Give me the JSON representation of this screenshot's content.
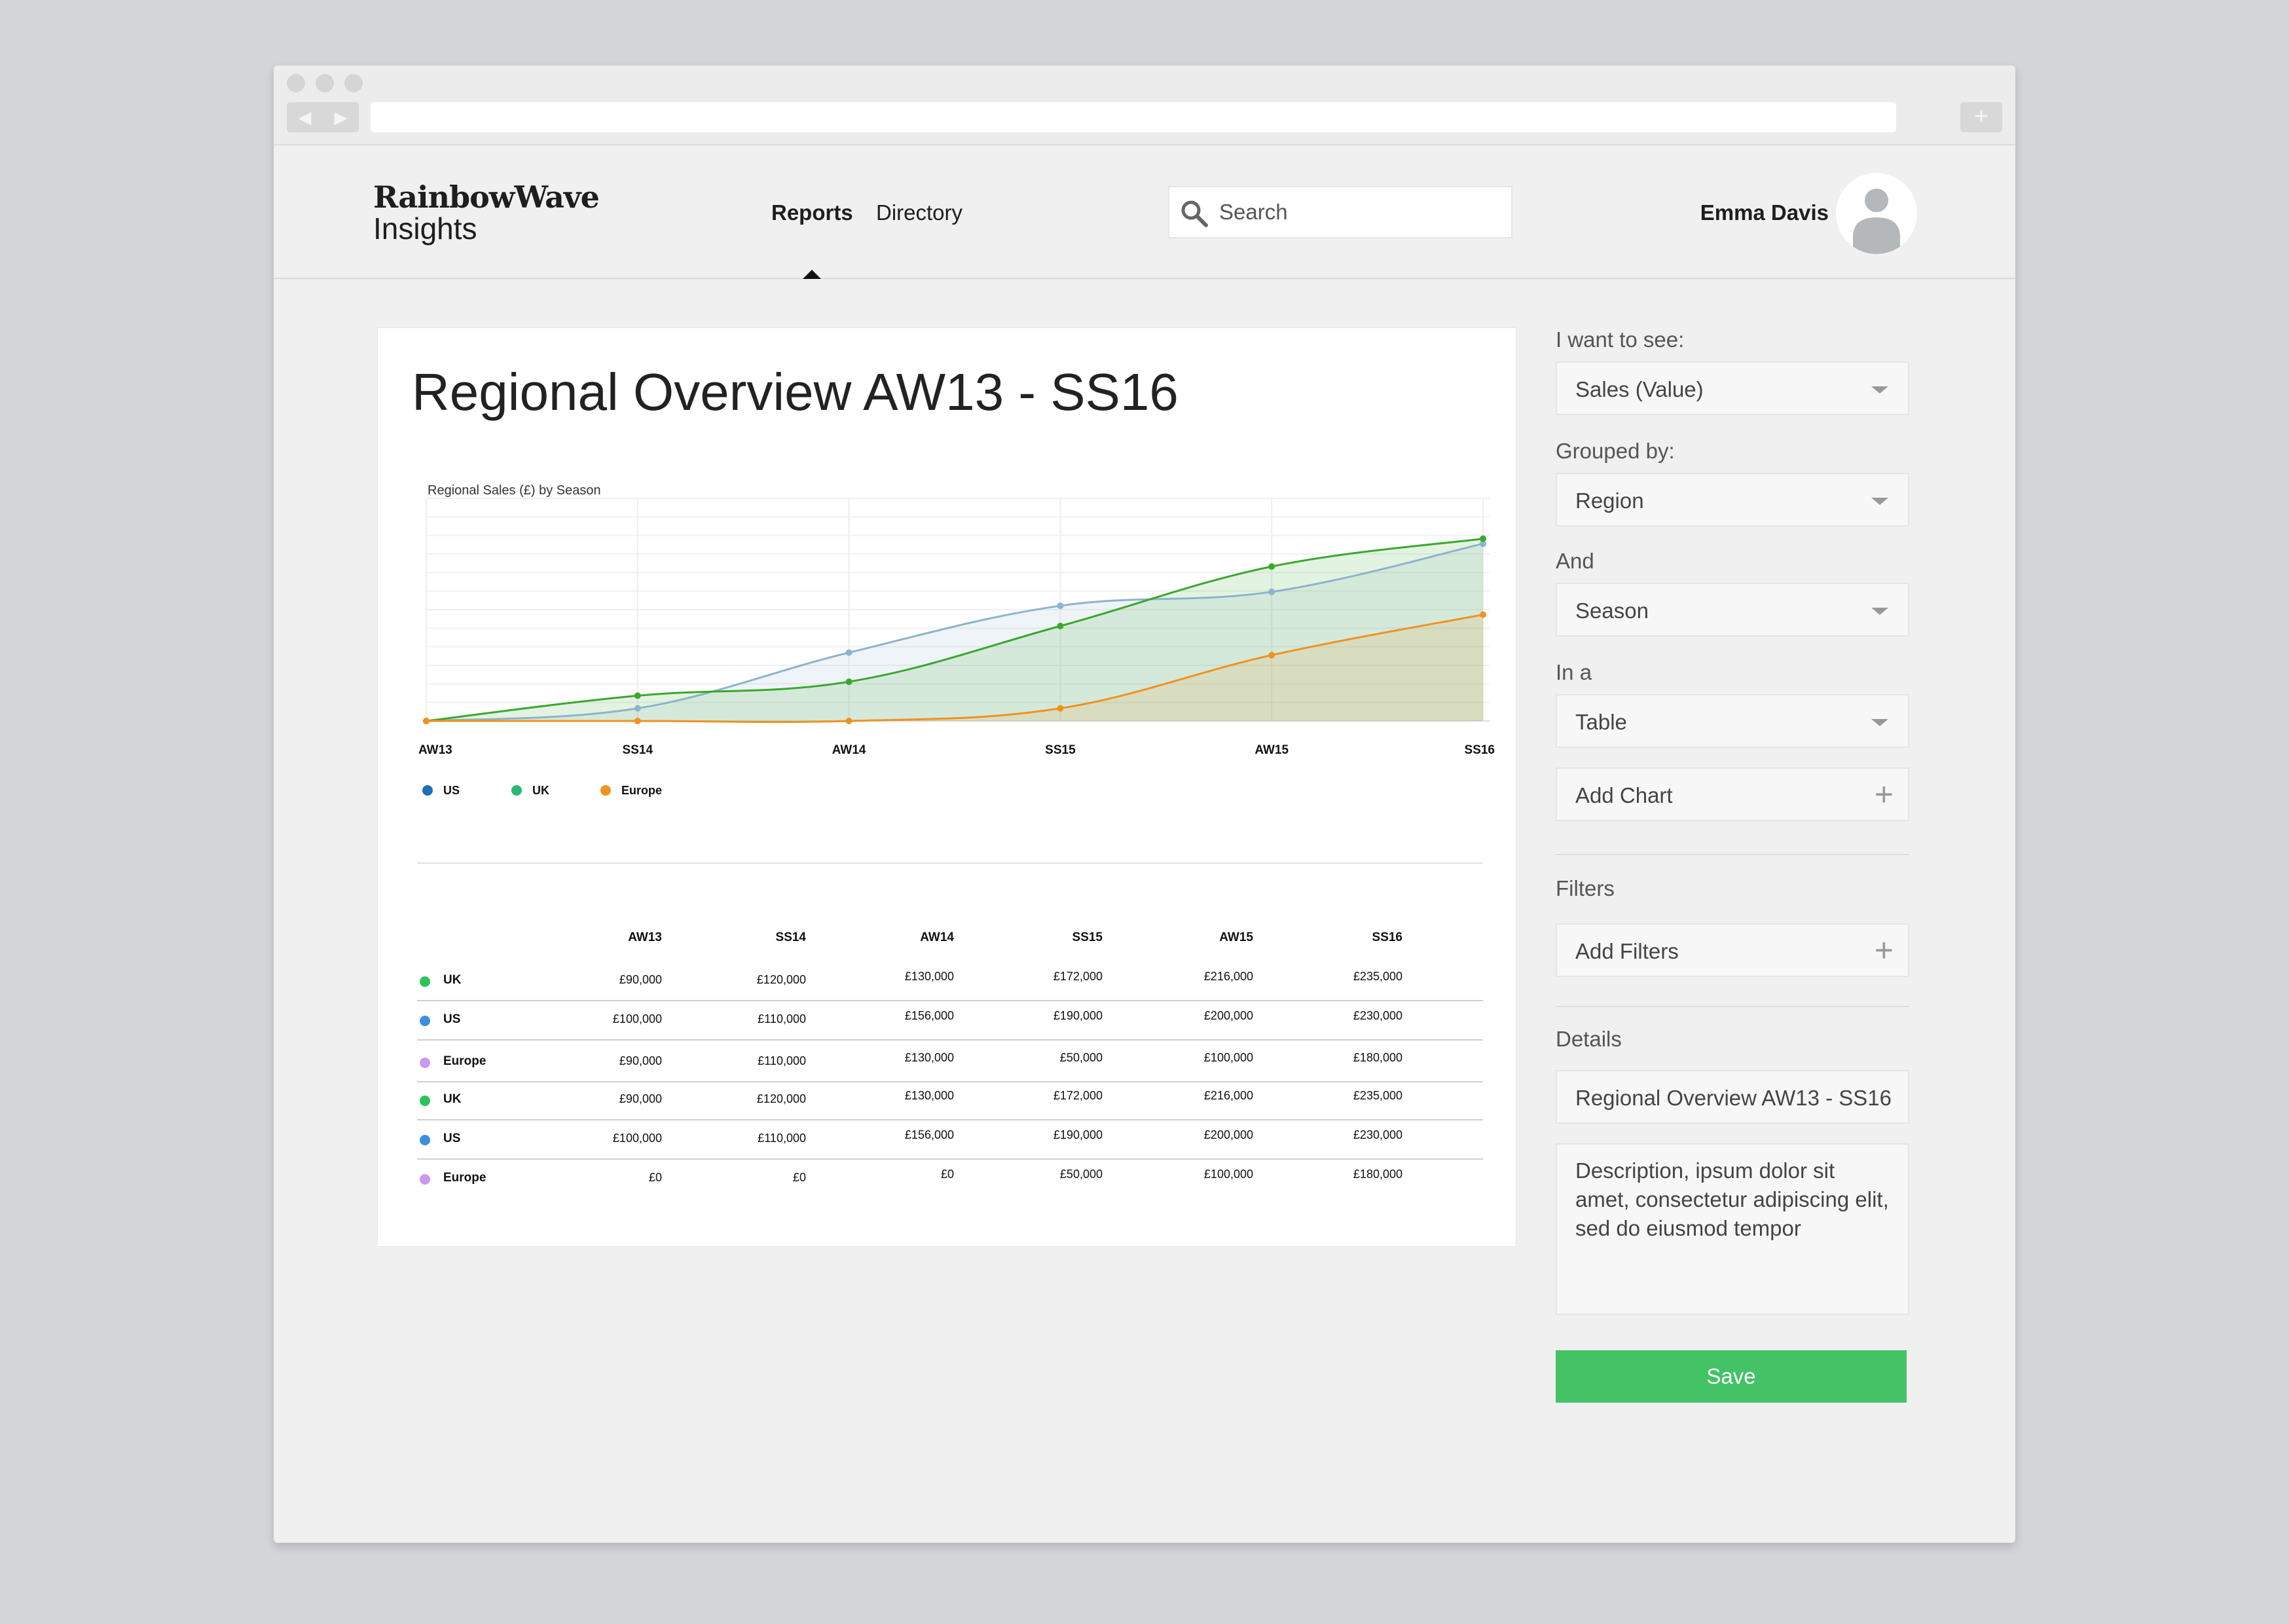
{
  "brand": {
    "line1": "RainbowWave",
    "line2": "Insights"
  },
  "nav": {
    "reports": "Reports",
    "directory": "Directory"
  },
  "search": {
    "placeholder": "Search"
  },
  "user": {
    "name": "Emma Davis"
  },
  "report": {
    "title": "Regional Overview AW13 - SS16"
  },
  "chart_data": {
    "type": "area",
    "title": "Regional Sales (£) by Season",
    "categories": [
      "AW13",
      "SS14",
      "AW14",
      "SS15",
      "AW15",
      "SS16"
    ],
    "series": [
      {
        "name": "US",
        "color": "#8db4cc",
        "legend_color": "#1f6fb5",
        "values": [
          0,
          50000,
          270000,
          455000,
          510000,
          700000
        ]
      },
      {
        "name": "UK",
        "color": "#3aa82d",
        "legend_color": "#2bb673",
        "values": [
          0,
          100000,
          155000,
          375000,
          610000,
          720000
        ]
      },
      {
        "name": "Europe",
        "color": "#f0921f",
        "legend_color": "#f0921f",
        "values": [
          0,
          0,
          0,
          50000,
          260000,
          420000
        ]
      }
    ],
    "ylim": [
      0,
      750000
    ],
    "grid": true,
    "legend": "bottom-left"
  },
  "table": {
    "columns": [
      "AW13",
      "SS14",
      "AW14",
      "SS15",
      "AW15",
      "SS16"
    ],
    "rows": [
      {
        "label": "UK",
        "color": "#2ec15a",
        "values": [
          "£90,000",
          "£120,000",
          "£130,000",
          "£172,000",
          "£216,000",
          "£235,000"
        ]
      },
      {
        "label": "US",
        "color": "#3b8fe0",
        "values": [
          "£100,000",
          "£110,000",
          "£156,000",
          "£190,000",
          "£200,000",
          "£230,000"
        ]
      },
      {
        "label": "Europe",
        "color": "#c99af0",
        "values": [
          "£90,000",
          "£110,000",
          "£130,000",
          "£50,000",
          "£100,000",
          "£180,000"
        ]
      },
      {
        "label": "UK",
        "color": "#2ec15a",
        "values": [
          "£90,000",
          "£120,000",
          "£130,000",
          "£172,000",
          "£216,000",
          "£235,000"
        ]
      },
      {
        "label": "US",
        "color": "#3b8fe0",
        "values": [
          "£100,000",
          "£110,000",
          "£156,000",
          "£190,000",
          "£200,000",
          "£230,000"
        ]
      },
      {
        "label": "Europe",
        "color": "#c99af0",
        "values": [
          "£0",
          "£0",
          "£0",
          "£50,000",
          "£100,000",
          "£180,000"
        ]
      }
    ]
  },
  "sidebar": {
    "want_label": "I want to see:",
    "want_value": "Sales (Value)",
    "grouped_label": "Grouped by:",
    "grouped_value": "Region",
    "and_label": "And",
    "and_value": "Season",
    "in_label": "In a",
    "in_value": "Table",
    "add_chart": "Add Chart",
    "filters_label": "Filters",
    "add_filters": "Add Filters",
    "details_label": "Details",
    "details_title": "Regional Overview AW13 - SS16",
    "description": "Description, ipsum dolor sit amet, consectetur adipiscing elit, sed do eiusmod tempor",
    "save": "Save"
  },
  "colors": {
    "accent": "#44c266"
  }
}
